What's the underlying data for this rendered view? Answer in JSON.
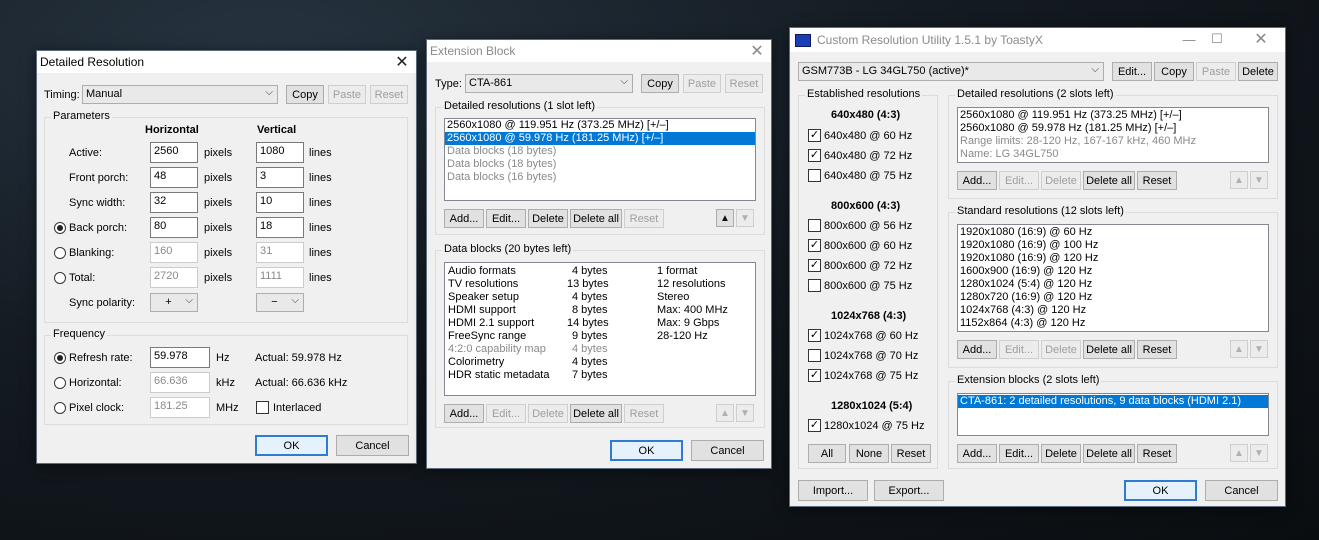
{
  "detailed": {
    "title": "Detailed Resolution",
    "timing_label": "Timing:",
    "timing_value": "Manual",
    "copy": "Copy",
    "paste": "Paste",
    "reset": "Reset",
    "parameters": "Parameters",
    "horizontal": "Horizontal",
    "vertical": "Vertical",
    "rows": [
      {
        "label": "Active:",
        "h": "2560",
        "hu": "pixels",
        "v": "1080",
        "vu": "lines"
      },
      {
        "label": "Front porch:",
        "h": "48",
        "hu": "pixels",
        "v": "3",
        "vu": "lines"
      },
      {
        "label": "Sync width:",
        "h": "32",
        "hu": "pixels",
        "v": "10",
        "vu": "lines"
      },
      {
        "label": "Back porch:",
        "h": "80",
        "hu": "pixels",
        "v": "18",
        "vu": "lines"
      },
      {
        "label": "Blanking:",
        "h": "160",
        "hu": "pixels",
        "v": "31",
        "vu": "lines"
      },
      {
        "label": "Total:",
        "h": "2720",
        "hu": "pixels",
        "v": "1111",
        "vu": "lines"
      }
    ],
    "sync_polarity": "Sync polarity:",
    "h_pol": "+",
    "v_pol": "−",
    "frequency": "Frequency",
    "refresh_label": "Refresh rate:",
    "refresh_value": "59.978",
    "refresh_unit": "Hz",
    "refresh_actual": "Actual: 59.978 Hz",
    "horiz_label": "Horizontal:",
    "horiz_value": "66.636",
    "horiz_unit": "kHz",
    "horiz_actual": "Actual: 66.636 kHz",
    "pclk_label": "Pixel clock:",
    "pclk_value": "181.25",
    "pclk_unit": "MHz",
    "interlaced": "Interlaced",
    "ok": "OK",
    "cancel": "Cancel"
  },
  "extension": {
    "title": "Extension Block",
    "type_label": "Type:",
    "type_value": "CTA-861",
    "copy": "Copy",
    "paste": "Paste",
    "reset": "Reset",
    "detailed_title": "Detailed resolutions (1 slot left)",
    "detailed_items": [
      "2560x1080 @ 119.951 Hz (373.25 MHz) [+/–]",
      "2560x1080 @ 59.978 Hz (181.25 MHz) [+/–]",
      "Data blocks (18 bytes)",
      "Data blocks (18 bytes)",
      "Data blocks (16 bytes)"
    ],
    "add": "Add...",
    "edit": "Edit...",
    "delete": "Delete",
    "delete_all": "Delete all",
    "data_title": "Data blocks (20 bytes left)",
    "data_rows": [
      {
        "name": "Audio formats",
        "bytes": "4 bytes",
        "info": "1 format"
      },
      {
        "name": "TV resolutions",
        "bytes": "13 bytes",
        "info": "12 resolutions"
      },
      {
        "name": "Speaker setup",
        "bytes": "4 bytes",
        "info": "Stereo"
      },
      {
        "name": "HDMI support",
        "bytes": "8 bytes",
        "info": "Max: 400 MHz"
      },
      {
        "name": "HDMI 2.1 support",
        "bytes": "14 bytes",
        "info": "Max: 9 Gbps"
      },
      {
        "name": "FreeSync range",
        "bytes": "9 bytes",
        "info": "28-120 Hz"
      },
      {
        "name": "4:2:0 capability map",
        "bytes": "4 bytes",
        "info": ""
      },
      {
        "name": "Colorimetry",
        "bytes": "4 bytes",
        "info": ""
      },
      {
        "name": "HDR static metadata",
        "bytes": "7 bytes",
        "info": ""
      }
    ],
    "ok": "OK",
    "cancel": "Cancel"
  },
  "cru": {
    "title": "Custom Resolution Utility 1.5.1 by ToastyX",
    "monitor": "GSM773B - LG 34GL750 (active)*",
    "edit": "Edit...",
    "copy": "Copy",
    "paste": "Paste",
    "delete": "Delete",
    "established_title": "Established resolutions",
    "est_groups": [
      {
        "head": "640x480 (4:3)",
        "items": [
          {
            "label": "640x480 @ 60 Hz",
            "checked": true
          },
          {
            "label": "640x480 @ 72 Hz",
            "checked": true
          },
          {
            "label": "640x480 @ 75 Hz",
            "checked": false
          }
        ]
      },
      {
        "head": "800x600 (4:3)",
        "items": [
          {
            "label": "800x600 @ 56 Hz",
            "checked": false
          },
          {
            "label": "800x600 @ 60 Hz",
            "checked": true
          },
          {
            "label": "800x600 @ 72 Hz",
            "checked": true
          },
          {
            "label": "800x600 @ 75 Hz",
            "checked": false
          }
        ]
      },
      {
        "head": "1024x768 (4:3)",
        "items": [
          {
            "label": "1024x768 @ 60 Hz",
            "checked": true
          },
          {
            "label": "1024x768 @ 70 Hz",
            "checked": false
          },
          {
            "label": "1024x768 @ 75 Hz",
            "checked": true
          }
        ]
      },
      {
        "head": "1280x1024 (5:4)",
        "items": [
          {
            "label": "1280x1024 @ 75 Hz",
            "checked": true
          }
        ]
      }
    ],
    "all": "All",
    "none": "None",
    "reset": "Reset",
    "detailed_title": "Detailed resolutions (2 slots left)",
    "detailed_items": [
      "2560x1080 @ 119.951 Hz (373.25 MHz) [+/–]",
      "2560x1080 @ 59.978 Hz (181.25 MHz) [+/–]",
      "Range limits: 28-120 Hz, 167-167 kHz, 460 MHz",
      "Name: LG 34GL750"
    ],
    "standard_title": "Standard resolutions (12 slots left)",
    "standard_items": [
      "1920x1080 (16:9) @ 60 Hz",
      "1920x1080 (16:9) @ 100 Hz",
      "1920x1080 (16:9) @ 120 Hz",
      "1600x900 (16:9) @ 120 Hz",
      "1280x1024 (5:4) @ 120 Hz",
      "1280x720 (16:9) @ 120 Hz",
      "1024x768 (4:3) @ 120 Hz",
      "1152x864 (4:3) @ 120 Hz"
    ],
    "extension_title": "Extension blocks (2 slots left)",
    "extension_items": [
      "CTA-861: 2 detailed resolutions, 9 data blocks (HDMI 2.1)"
    ],
    "add": "Add...",
    "edit_btn": "Edit...",
    "delete_btn": "Delete",
    "delete_all": "Delete all",
    "reset_btn": "Reset",
    "import": "Import...",
    "export": "Export...",
    "ok": "OK",
    "cancel": "Cancel"
  }
}
